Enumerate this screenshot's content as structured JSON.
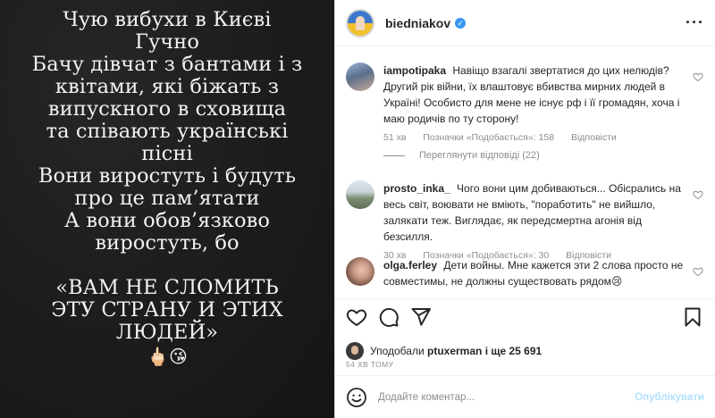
{
  "story": {
    "lines": [
      "Чую вибухи в Києві",
      "Гучно",
      "Бачу дівчат з бантами і з",
      "квітами, які біжать з",
      "випускного в сховища",
      "та співають українські",
      "пісні",
      "Вони виростуть і будуть",
      "про це пам’ятати",
      "А вони обов’язково",
      "виростуть, бо"
    ],
    "quote_lines": [
      "«ВАМ НЕ СЛОМИТЬ",
      "ЭТУ СТРАНУ И ЭТИХ",
      "ЛЮДЕЙ»"
    ],
    "emoji": "🖕🏻😘"
  },
  "post": {
    "username": "biedniakov",
    "verified_mark": "✓",
    "more": "···"
  },
  "comments": [
    {
      "user": "iampotipaka",
      "text": "Навіщо взагалі звертатися до цих нелюдів? Другий рік війни, їх влаштовує вбивства мирних людей в Україні! Особисто для мене не існує рф і її громадян, хоча і маю родичів по ту сторону!",
      "time": "51 хв",
      "likes": "Позначки «Подобається»: 158",
      "reply": "Відповісти"
    },
    {
      "user": "prosto_inka_",
      "text": "Чого вони цим добиваються... Обісрались на весь світ, воювати не вміють, \"поработить\" не вийшло, залякати теж. Виглядає, як передсмертна агонія від безсилля.",
      "time": "30 хв",
      "likes": "Позначки «Подобається»: 30",
      "reply": "Відповісти"
    },
    {
      "user": "olga.ferley",
      "text": "Дети войны. Мне кажется эти 2 слова просто не совместимы, не должны существовать рядом😢",
      "time": "",
      "likes": "",
      "reply": ""
    }
  ],
  "view_replies": "Переглянути відповіді (22)",
  "liked_by": {
    "prefix": "Уподобали",
    "user": "ptuxerman",
    "suffix": "і ще 25 691"
  },
  "time_ago": "54 ХВ ТОМУ",
  "composer": {
    "placeholder": "Додайте коментар...",
    "publish": "Опублікувати"
  }
}
